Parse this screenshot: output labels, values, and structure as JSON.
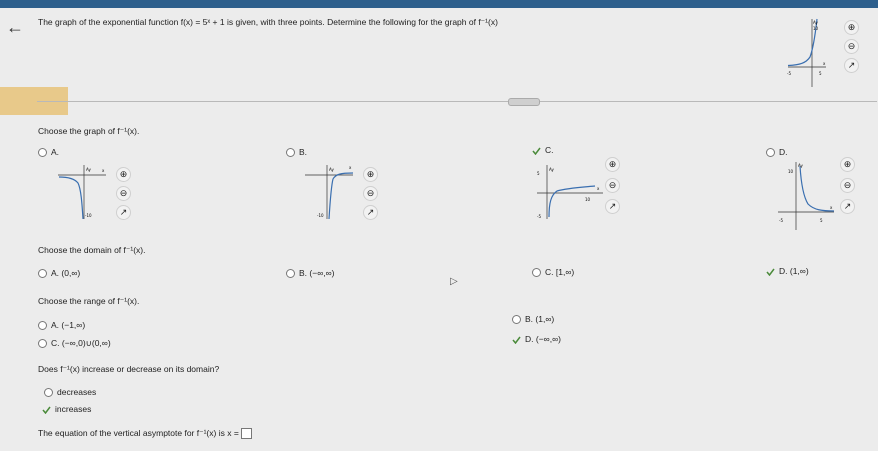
{
  "header": {
    "back_icon": "arrow-left-icon",
    "question": "The graph of the exponential function f(x) = 5ˣ + 1 is given, with three points. Determine the following for the graph of f⁻¹(x)"
  },
  "graph_prompt": "Choose the graph of f⁻¹(x).",
  "graph_options": [
    {
      "letter": "A.",
      "selected": false
    },
    {
      "letter": "B.",
      "selected": false
    },
    {
      "letter": "C.",
      "selected": true
    },
    {
      "letter": "D.",
      "selected": false
    }
  ],
  "domain_prompt": "Choose the domain of f⁻¹(x).",
  "domain_options": [
    {
      "letter": "A.",
      "text": "(0,∞)",
      "selected": false
    },
    {
      "letter": "B.",
      "text": "(−∞,∞)",
      "selected": false
    },
    {
      "letter": "C.",
      "text": "[1,∞)",
      "selected": false
    },
    {
      "letter": "D.",
      "text": "(1,∞)",
      "selected": true
    }
  ],
  "range_prompt": "Choose the range of f⁻¹(x).",
  "range_options": [
    {
      "letter": "A.",
      "text": "(−1,∞)",
      "selected": false
    },
    {
      "letter": "B.",
      "text": "(1,∞)",
      "selected": false
    },
    {
      "letter": "C.",
      "text": "(−∞,0)∪(0,∞)",
      "selected": false
    },
    {
      "letter": "D.",
      "text": "(−∞,∞)",
      "selected": true
    }
  ],
  "behavior_prompt": "Does f⁻¹(x) increase or decrease on its domain?",
  "behavior_options": [
    {
      "text": "decreases",
      "selected": false
    },
    {
      "text": "increases",
      "selected": true
    }
  ],
  "asymptote_prompt": "The equation of the vertical asymptote for f⁻¹(x) is x =",
  "graph_labels": {
    "y": "Ay",
    "x": "x",
    "ten": "10",
    "neg_ten": "-10",
    "five": "5",
    "neg_five": "-5"
  },
  "colors": {
    "accent": "#2d5f8c",
    "curve": "#3a6fb0",
    "check": "#4a8a3a"
  }
}
